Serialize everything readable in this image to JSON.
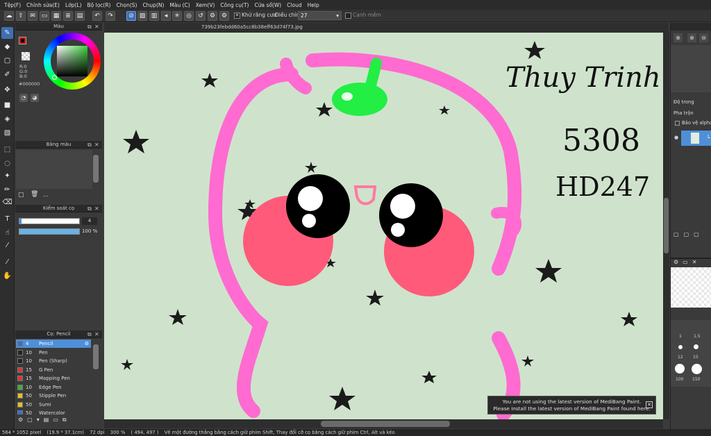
{
  "menu": [
    "Tệp(F)",
    "Chỉnh sửa(E)",
    "Lớp(L)",
    "Bộ lọc(R)",
    "Chọn(S)",
    "Chụp(N)",
    "Màu (C)",
    "Xem(V)",
    "Công cụ(T)",
    "Cửa sổ(W)",
    "Cloud",
    "Help"
  ],
  "toolbar": {
    "antialias_label": "Khử răng cưa",
    "adjust_label": "Điều chỉnh",
    "adjust_value": "27",
    "edge_label": "Cạnh mềm"
  },
  "document": {
    "filename": "739b23febdd60a5cc8b38eff63d74f73.jpg"
  },
  "color_panel": {
    "title": "Màu",
    "r": "R:0",
    "g": "G:0",
    "b": "B:0",
    "hex": "#000000",
    "fg": "#000000",
    "bg": "#ffffff"
  },
  "palette_panel": {
    "title": "Bảng màu",
    "more": "..."
  },
  "brush_control": {
    "title": "Kiểm soát cọ",
    "size": "4",
    "opacity": "100 %",
    "opacity_fraction": 1.0
  },
  "brush_panel": {
    "title": "Cọ: Pencil",
    "items": [
      {
        "size": "4",
        "name": "Pencil",
        "color": "#3e6fb3",
        "selected": true
      },
      {
        "size": "10",
        "name": "Pen",
        "color": "#222222"
      },
      {
        "size": "10",
        "name": "Pen (Sharp)",
        "color": "#222222"
      },
      {
        "size": "15",
        "name": "G Pen",
        "color": "#d03a3a"
      },
      {
        "size": "15",
        "name": "Mapping Pen",
        "color": "#d03a3a"
      },
      {
        "size": "10",
        "name": "Edge Pen",
        "color": "#3ab03a"
      },
      {
        "size": "50",
        "name": "Stipple Pen",
        "color": "#e0c020"
      },
      {
        "size": "50",
        "name": "Sumi",
        "color": "#e0c020"
      },
      {
        "size": "50",
        "name": "Watercolor",
        "color": "#3a6fd0"
      }
    ]
  },
  "layer_panel": {
    "opacity_label": "Độ trong",
    "blend_label": "Pha trộn",
    "protect_alpha": "Bảo vệ alpha",
    "layer_initial": "L"
  },
  "brush_sizes": [
    "1",
    "1.5",
    "12",
    "15",
    "100",
    "150"
  ],
  "artwork": {
    "line1": "Thuy Trinh",
    "line2": "5308",
    "line3": "HD247",
    "body_color": "#ff6bd0",
    "cheek_color": "#ff5a7a",
    "sprout_color": "#22ee44"
  },
  "notice": {
    "line1": "You are not using the latest version of MediBang Paint.",
    "line2": "Please install the latest version of MediBang Paint found here."
  },
  "status": {
    "size": "564 * 1052 pixel",
    "physical": "(19.9 * 37.1cm)",
    "dpi": "72 dpi",
    "zoom": "300 %",
    "coords": "( 494, 497 )",
    "hint": "Vẽ một đường thẳng bằng cách giữ phím Shift, Thay đổi cỡ cọ bằng cách giữ phím Ctrl, Alt và kéo"
  }
}
